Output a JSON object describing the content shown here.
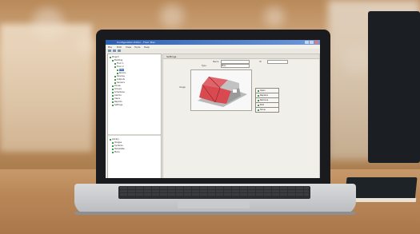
{
  "app": {
    "title": "Configuration Editor - Floor Plan",
    "menu": [
      "File",
      "Edit",
      "View",
      "Tools",
      "Help"
    ]
  },
  "tree": {
    "items": [
      {
        "label": "Project",
        "indent": 0
      },
      {
        "label": "Building",
        "indent": 1
      },
      {
        "label": "Floor 1",
        "indent": 2
      },
      {
        "label": "Floor 2",
        "indent": 2
      },
      {
        "label": "Area",
        "indent": 3,
        "selected": true
      },
      {
        "label": "Rooms",
        "indent": 3
      },
      {
        "label": "Devices",
        "indent": 2
      },
      {
        "label": "Outputs",
        "indent": 2
      },
      {
        "label": "Sensors",
        "indent": 2
      },
      {
        "label": "Zones",
        "indent": 1
      },
      {
        "label": "Groups",
        "indent": 1
      },
      {
        "label": "Schedules",
        "indent": 1
      },
      {
        "label": "Alarms",
        "indent": 1
      },
      {
        "label": "Users",
        "indent": 1
      },
      {
        "label": "Reports",
        "indent": 1
      },
      {
        "label": "Settings",
        "indent": 1
      }
    ],
    "bottom_items": [
      {
        "label": "Library",
        "indent": 0
      },
      {
        "label": "Images",
        "indent": 1
      },
      {
        "label": "Symbols",
        "indent": 1
      },
      {
        "label": "Templates",
        "indent": 1
      },
      {
        "label": "Plans",
        "indent": 1
      }
    ]
  },
  "panel": {
    "header": "Settings",
    "name_label": "Name",
    "name_value": "",
    "type_label": "Type",
    "type_value": "Plan",
    "id_label": "ID",
    "image_label": "Image",
    "buttons": [
      "Open",
      "Replace",
      "Remove",
      "Edit",
      "Show"
    ]
  },
  "colors": {
    "titlebar": "#2f5fb0",
    "highlight": "#d84a4f",
    "selection": "#2f63b6"
  }
}
